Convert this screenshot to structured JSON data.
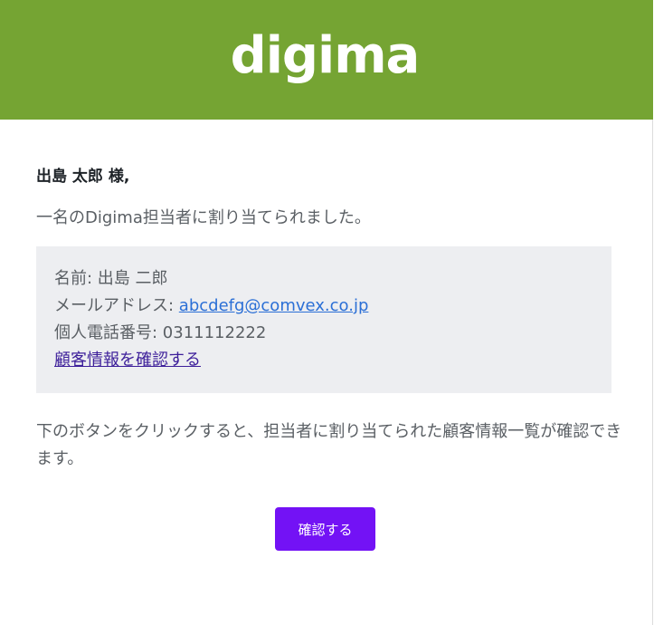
{
  "header": {
    "logo_text": "digima",
    "background_color": "#75a433"
  },
  "message": {
    "greeting": "出島 太郎 様,",
    "intro": "一名のDigima担当者に割り当てられました。",
    "assignee": {
      "name_label": "名前: ",
      "name_value": "出島 二郎",
      "email_label": "メールアドレス: ",
      "email_value": "abcdefg@comvex.co.jp",
      "phone_label": "個人電話番号: ",
      "phone_value": "0311112222",
      "detail_link": "顧客情報を確認する"
    },
    "note": "下のボタンをクリックすると、担当者に割り当てられた顧客情報一覧が確認できます。",
    "button_label": "確認する",
    "button_color": "#7312f5"
  }
}
